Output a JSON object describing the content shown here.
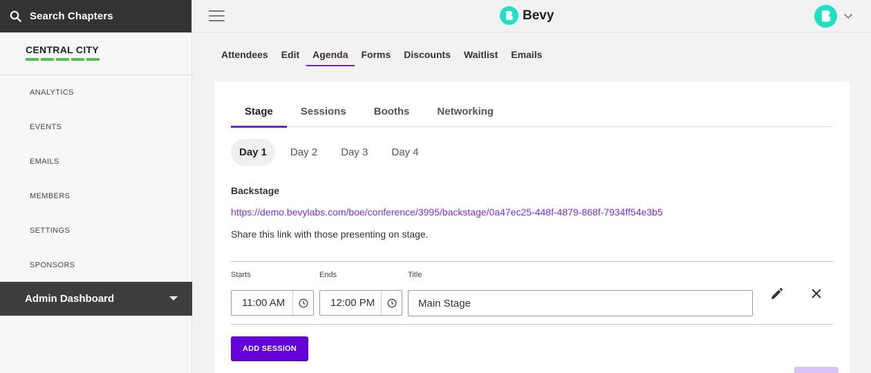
{
  "sidebar": {
    "search_label": "Search Chapters",
    "chapter_name": "CENTRAL CITY",
    "items": [
      {
        "label": "ANALYTICS"
      },
      {
        "label": "EVENTS"
      },
      {
        "label": "EMAILS"
      },
      {
        "label": "MEMBERS"
      },
      {
        "label": "SETTINGS"
      },
      {
        "label": "SPONSORS"
      }
    ],
    "admin_label": "Admin Dashboard"
  },
  "header": {
    "brand": "Bevy"
  },
  "section_tabs": [
    {
      "label": "Attendees"
    },
    {
      "label": "Edit"
    },
    {
      "label": "Agenda",
      "active": true
    },
    {
      "label": "Forms"
    },
    {
      "label": "Discounts"
    },
    {
      "label": "Waitlist"
    },
    {
      "label": "Emails"
    }
  ],
  "card": {
    "tabs": [
      {
        "label": "Stage",
        "active": true
      },
      {
        "label": "Sessions"
      },
      {
        "label": "Booths"
      },
      {
        "label": "Networking"
      }
    ],
    "days": [
      {
        "label": "Day 1",
        "active": true
      },
      {
        "label": "Day 2"
      },
      {
        "label": "Day 3"
      },
      {
        "label": "Day 4"
      }
    ],
    "backstage_title": "Backstage",
    "backstage_link": "https://demo.bevylabs.com/boe/conference/3995/backstage/0a47ec25-448f-4879-868f-7934ff54e3b5",
    "backstage_note": "Share this link with those presenting on stage.",
    "session": {
      "starts_label": "Starts",
      "ends_label": "Ends",
      "title_label": "Title",
      "starts_value": "11:00 AM",
      "ends_value": "12:00 PM",
      "title_value": "Main Stage"
    },
    "add_session_label": "ADD SESSION"
  },
  "colors": {
    "accent": "#6a20c9",
    "button": "#6200d6",
    "brand": "#1ee0c4",
    "chapter_underline": "#4ec24e",
    "sidebar_dark": "#333333"
  },
  "icons": [
    "search-icon",
    "hamburger-icon",
    "bevy-logo-icon",
    "avatar-icon",
    "chevron-down-icon",
    "clock-icon",
    "pencil-icon",
    "close-icon",
    "caret-down-icon"
  ]
}
